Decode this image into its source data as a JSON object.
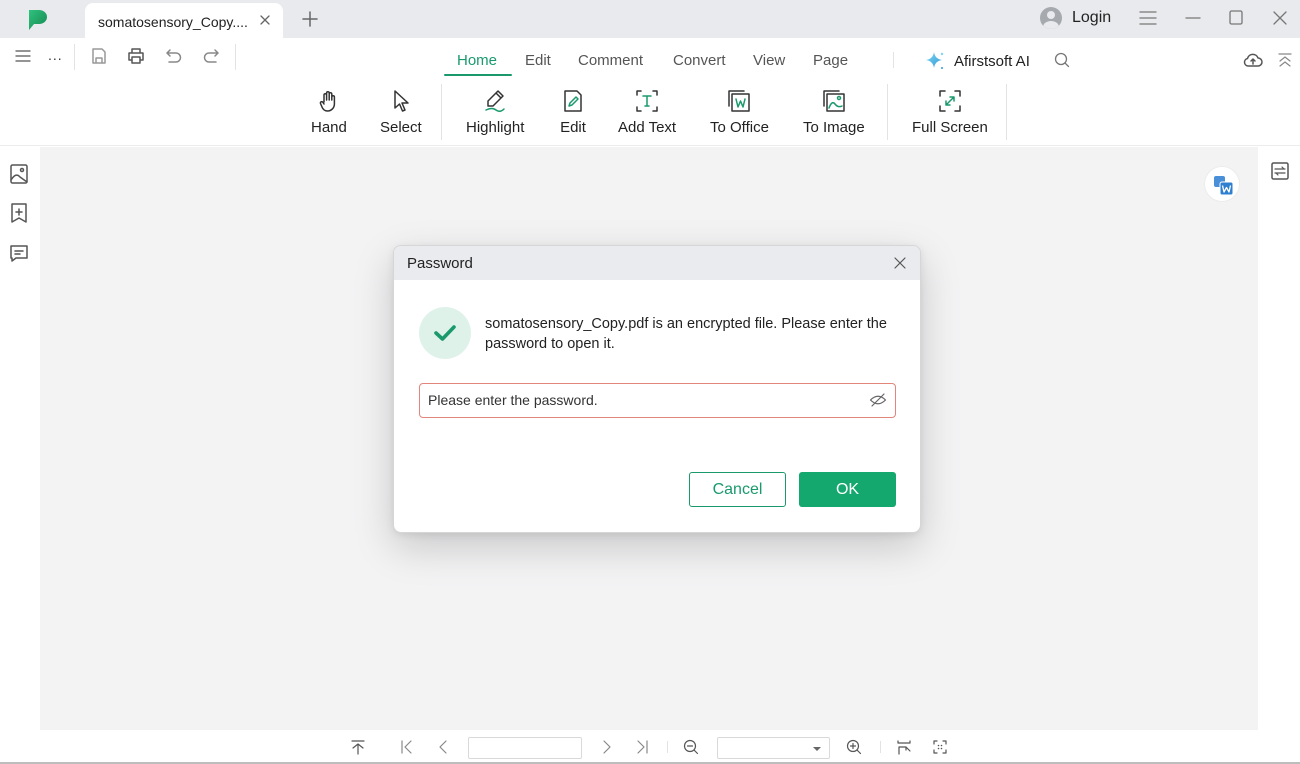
{
  "titlebar": {
    "tab_title": "somatosensory_Copy....",
    "login_label": "Login"
  },
  "menu": {
    "tabs": [
      {
        "label": "Home",
        "active": true
      },
      {
        "label": "Edit",
        "active": false
      },
      {
        "label": "Comment",
        "active": false
      },
      {
        "label": "Convert",
        "active": false
      },
      {
        "label": "View",
        "active": false
      },
      {
        "label": "Page",
        "active": false
      }
    ],
    "more_label": "...",
    "ai_label": "Afirstsoft AI"
  },
  "ribbon": {
    "tools": [
      {
        "label": "Hand",
        "icon": "hand-icon"
      },
      {
        "label": "Select",
        "icon": "cursor-icon"
      },
      {
        "label": "Highlight",
        "icon": "highlighter-icon"
      },
      {
        "label": "Edit",
        "icon": "edit-document-icon"
      },
      {
        "label": "Add Text",
        "icon": "add-text-icon"
      },
      {
        "label": "To Office",
        "icon": "word-convert-icon"
      },
      {
        "label": "To Image",
        "icon": "image-convert-icon"
      },
      {
        "label": "Full Screen",
        "icon": "fullscreen-icon"
      }
    ]
  },
  "sidebar": {
    "items": [
      {
        "icon": "thumbnail-icon"
      },
      {
        "icon": "bookmark-icon"
      },
      {
        "icon": "comment-icon"
      }
    ]
  },
  "dialog": {
    "title": "Password",
    "message": "somatosensory_Copy.pdf is an encrypted file. Please enter the password to open it.",
    "password_value": "",
    "password_placeholder": "Please enter the password.",
    "cancel_label": "Cancel",
    "ok_label": "OK"
  },
  "bottom_bar": {
    "page_value": "",
    "zoom_value": ""
  },
  "colors": {
    "accent": "#1a9a6c",
    "ok_button": "#14a86e",
    "input_error_border": "#e2857a",
    "titlebar_bg": "#e8eaed",
    "doc_bg": "#f3f3f4"
  }
}
